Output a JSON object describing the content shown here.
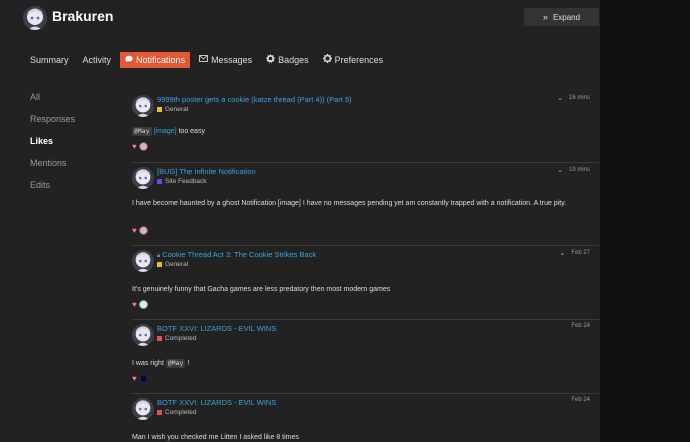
{
  "header": {
    "username": "Brakuren",
    "expand_label": "Expand",
    "expand_icon": "chevrons-icon"
  },
  "tabs": [
    {
      "label": "Summary",
      "icon": ""
    },
    {
      "label": "Activity",
      "icon": ""
    },
    {
      "label": "Notifications",
      "icon": "comment-icon",
      "active": true
    },
    {
      "label": "Messages",
      "icon": "envelope-icon"
    },
    {
      "label": "Badges",
      "icon": "badge-icon"
    },
    {
      "label": "Preferences",
      "icon": "gear-icon"
    }
  ],
  "sidebar": {
    "items": [
      {
        "label": "All"
      },
      {
        "label": "Responses"
      },
      {
        "label": "Likes",
        "active": true
      },
      {
        "label": "Mentions"
      },
      {
        "label": "Edits"
      }
    ]
  },
  "posts": [
    {
      "title": "9999th poster gets a cookie (katze thread (Part 4)) (Part 5)",
      "category": "General",
      "category_color": "#e6c21c",
      "time": "16 mins",
      "body_mention": "@May",
      "body_link": "[image]",
      "body_text": "too easy"
    },
    {
      "title": "[BUG] The Infinite Notification",
      "category": "Site Feedback",
      "category_color": "#6b46e6",
      "time": "19 mins",
      "body_text": "I have become haunted by a ghost Notification [image] I have no messages pending yet am constantly trapped with a notification. A true pity."
    },
    {
      "title": "Cookie Thread Act 3: The Cookie Strikes Back",
      "category": "General",
      "category_color": "#e6c21c",
      "time": "Feb 27",
      "locked": true,
      "body_text": "It’s genuinely funny that Gacha games are less predatory then most modern games"
    },
    {
      "title": "BOTF XXVI: LIZARDS - EVIL WINS",
      "category": "Completed",
      "category_color": "#e45050",
      "time": "Feb 24",
      "body_text": "I was right",
      "body_mention": "@May",
      "body_tail": "!"
    },
    {
      "title": "BOTF XXVI: LIZARDS - EVIL WINS",
      "category": "Completed",
      "category_color": "#e45050",
      "time": "Feb 24",
      "body_text": "Man I wish you checked me Litten I asked like 8 times"
    }
  ],
  "colors": {
    "background": "#111111",
    "panel": "#222222",
    "accent": "#e45735",
    "link": "#3aa3dd",
    "like": "#ff6fa3"
  }
}
